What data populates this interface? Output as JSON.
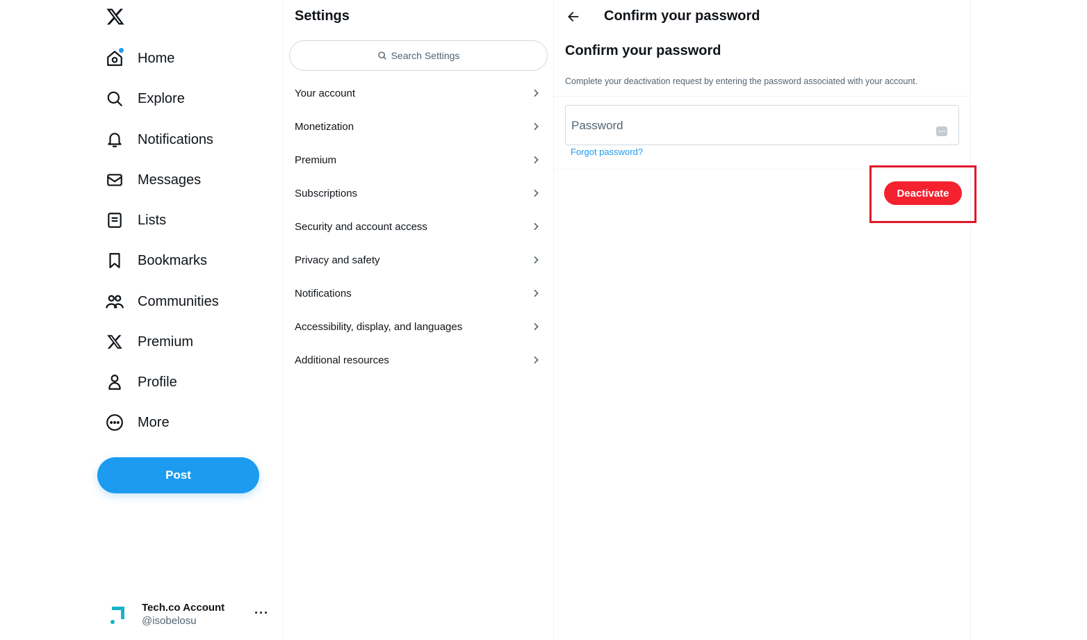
{
  "nav": {
    "items": [
      {
        "label": "Home",
        "icon": "home-icon"
      },
      {
        "label": "Explore",
        "icon": "search-icon"
      },
      {
        "label": "Notifications",
        "icon": "bell-icon"
      },
      {
        "label": "Messages",
        "icon": "envelope-icon"
      },
      {
        "label": "Lists",
        "icon": "list-icon"
      },
      {
        "label": "Bookmarks",
        "icon": "bookmark-icon"
      },
      {
        "label": "Communities",
        "icon": "people-icon"
      },
      {
        "label": "Premium",
        "icon": "x-logo-icon"
      },
      {
        "label": "Profile",
        "icon": "person-icon"
      },
      {
        "label": "More",
        "icon": "more-circle-icon"
      }
    ],
    "post_label": "Post",
    "account": {
      "name": "Tech.co Account",
      "handle": "@isobelosu",
      "more": "···"
    }
  },
  "settings": {
    "title": "Settings",
    "search_placeholder": "Search Settings",
    "items": [
      {
        "label": "Your account"
      },
      {
        "label": "Monetization"
      },
      {
        "label": "Premium"
      },
      {
        "label": "Subscriptions"
      },
      {
        "label": "Security and account access"
      },
      {
        "label": "Privacy and safety"
      },
      {
        "label": "Notifications"
      },
      {
        "label": "Accessibility, display, and languages"
      },
      {
        "label": "Additional resources"
      }
    ]
  },
  "panel": {
    "header": "Confirm your password",
    "title": "Confirm your password",
    "description": "Complete your deactivation request by entering the password associated with your account.",
    "password_placeholder": "Password",
    "forgot_label": "Forgot password?",
    "deactivate_label": "Deactivate"
  },
  "colors": {
    "accent": "#1d9bf0",
    "danger": "#f4212e",
    "highlight_border": "#e0182a"
  }
}
